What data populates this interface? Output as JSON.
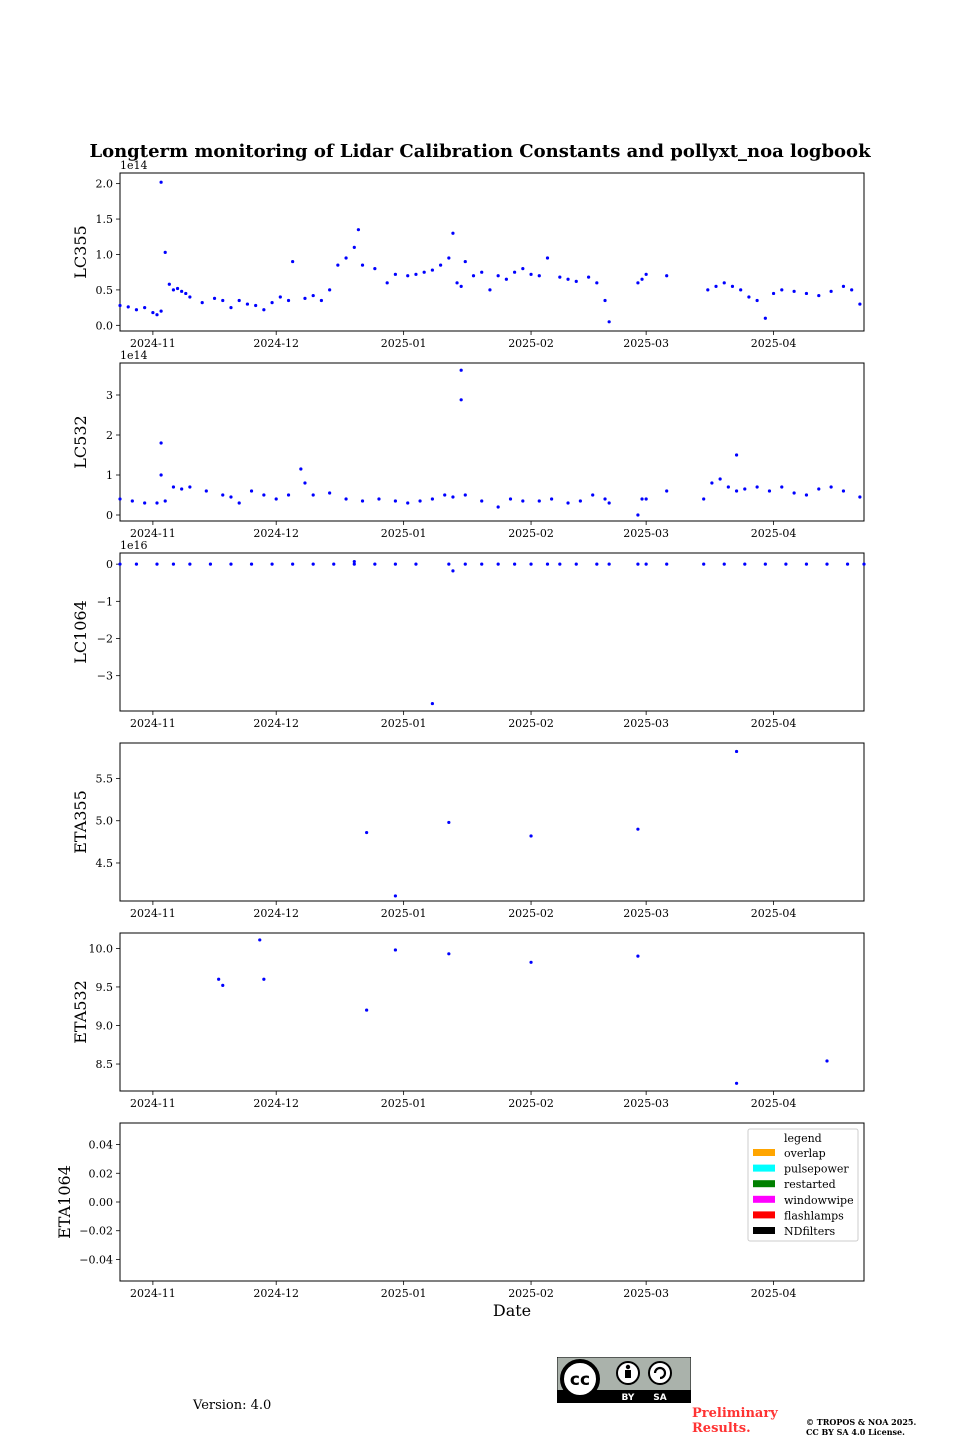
{
  "title": "Longterm monitoring of Lidar Calibration Constants and pollyxt_noa logbook",
  "footer": {
    "version": "Version: 4.0",
    "preliminary_line1": "Preliminary",
    "preliminary_line2": "Results.",
    "copyright_line1": "© TROPOS & NOA 2025.",
    "copyright_line2": "CC BY SA 4.0 License.",
    "license_badge": {
      "cc": "cc",
      "by": "BY",
      "sa": "SA"
    }
  },
  "chart_data": [
    {
      "type": "scatter",
      "ylabel": "LC355",
      "exponent": "1e14",
      "color": "#0000ff",
      "ylim": [
        -0.08,
        2.15
      ],
      "yticks": [
        "0.0",
        "0.5",
        "1.0",
        "1.5",
        "2.0"
      ],
      "ytick_values": [
        0.0,
        0.5,
        1.0,
        1.5,
        2.0
      ],
      "xlim": [
        "2024-10-24",
        "2025-04-23"
      ],
      "xticks": [
        "2024-11",
        "2024-12",
        "2025-01",
        "2025-02",
        "2025-03",
        "2025-04"
      ],
      "x": [
        "2024-10-24",
        "2024-10-26",
        "2024-10-28",
        "2024-10-30",
        "2024-11-01",
        "2024-11-02",
        "2024-11-03",
        "2024-11-03",
        "2024-11-04",
        "2024-11-05",
        "2024-11-06",
        "2024-11-07",
        "2024-11-08",
        "2024-11-09",
        "2024-11-10",
        "2024-11-13",
        "2024-11-16",
        "2024-11-18",
        "2024-11-20",
        "2024-11-22",
        "2024-11-24",
        "2024-11-26",
        "2024-11-28",
        "2024-11-30",
        "2024-12-02",
        "2024-12-04",
        "2024-12-05",
        "2024-12-08",
        "2024-12-10",
        "2024-12-12",
        "2024-12-14",
        "2024-12-16",
        "2024-12-18",
        "2024-12-20",
        "2024-12-21",
        "2024-12-22",
        "2024-12-25",
        "2024-12-28",
        "2024-12-30",
        "2025-01-02",
        "2025-01-04",
        "2025-01-06",
        "2025-01-08",
        "2025-01-10",
        "2025-01-12",
        "2025-01-13",
        "2025-01-14",
        "2025-01-15",
        "2025-01-16",
        "2025-01-18",
        "2025-01-20",
        "2025-01-22",
        "2025-01-24",
        "2025-01-26",
        "2025-01-28",
        "2025-01-30",
        "2025-02-01",
        "2025-02-03",
        "2025-02-05",
        "2025-02-08",
        "2025-02-10",
        "2025-02-12",
        "2025-02-15",
        "2025-02-17",
        "2025-02-19",
        "2025-02-20",
        "2025-02-27",
        "2025-02-28",
        "2025-03-01",
        "2025-03-06",
        "2025-03-16",
        "2025-03-18",
        "2025-03-20",
        "2025-03-22",
        "2025-03-24",
        "2025-03-26",
        "2025-03-28",
        "2025-03-30",
        "2025-04-01",
        "2025-04-03",
        "2025-04-06",
        "2025-04-09",
        "2025-04-12",
        "2025-04-15",
        "2025-04-18",
        "2025-04-20",
        "2025-04-22"
      ],
      "y": [
        0.28,
        0.26,
        0.22,
        0.25,
        0.18,
        0.15,
        0.2,
        2.02,
        1.03,
        0.58,
        0.5,
        0.52,
        0.48,
        0.45,
        0.4,
        0.32,
        0.38,
        0.35,
        0.25,
        0.35,
        0.3,
        0.28,
        0.22,
        0.32,
        0.4,
        0.35,
        0.9,
        0.38,
        0.42,
        0.35,
        0.5,
        0.85,
        0.95,
        1.1,
        1.35,
        0.85,
        0.8,
        0.6,
        0.72,
        0.7,
        0.72,
        0.75,
        0.78,
        0.85,
        0.95,
        1.3,
        0.6,
        0.55,
        0.9,
        0.7,
        0.75,
        0.5,
        0.7,
        0.65,
        0.75,
        0.8,
        0.72,
        0.7,
        0.95,
        0.68,
        0.65,
        0.62,
        0.68,
        0.6,
        0.35,
        0.05,
        0.6,
        0.65,
        0.72,
        0.7,
        0.5,
        0.55,
        0.6,
        0.55,
        0.5,
        0.4,
        0.35,
        0.1,
        0.45,
        0.5,
        0.48,
        0.45,
        0.42,
        0.48,
        0.55,
        0.5,
        0.3
      ]
    },
    {
      "type": "scatter",
      "ylabel": "LC532",
      "exponent": "1e14",
      "color": "#0000ff",
      "ylim": [
        -0.15,
        3.8
      ],
      "yticks": [
        "0",
        "1",
        "2",
        "3"
      ],
      "ytick_values": [
        0,
        1,
        2,
        3
      ],
      "xlim": [
        "2024-10-24",
        "2025-04-23"
      ],
      "xticks": [
        "2024-11",
        "2024-12",
        "2025-01",
        "2025-02",
        "2025-03",
        "2025-04"
      ],
      "x": [
        "2024-10-24",
        "2024-10-27",
        "2024-10-30",
        "2024-11-02",
        "2024-11-03",
        "2024-11-03",
        "2024-11-04",
        "2024-11-06",
        "2024-11-08",
        "2024-11-10",
        "2024-11-14",
        "2024-11-18",
        "2024-11-20",
        "2024-11-22",
        "2024-11-25",
        "2024-11-28",
        "2024-12-01",
        "2024-12-04",
        "2024-12-07",
        "2024-12-08",
        "2024-12-10",
        "2024-12-14",
        "2024-12-18",
        "2024-12-22",
        "2024-12-26",
        "2024-12-30",
        "2025-01-02",
        "2025-01-05",
        "2025-01-08",
        "2025-01-11",
        "2025-01-13",
        "2025-01-15",
        "2025-01-15",
        "2025-01-16",
        "2025-01-20",
        "2025-01-24",
        "2025-01-27",
        "2025-01-30",
        "2025-02-03",
        "2025-02-06",
        "2025-02-10",
        "2025-02-13",
        "2025-02-16",
        "2025-02-19",
        "2025-02-20",
        "2025-02-27",
        "2025-02-28",
        "2025-03-01",
        "2025-03-06",
        "2025-03-15",
        "2025-03-17",
        "2025-03-19",
        "2025-03-21",
        "2025-03-23",
        "2025-03-23",
        "2025-03-25",
        "2025-03-28",
        "2025-03-31",
        "2025-04-03",
        "2025-04-06",
        "2025-04-09",
        "2025-04-12",
        "2025-04-15",
        "2025-04-18",
        "2025-04-22"
      ],
      "y": [
        0.4,
        0.35,
        0.3,
        0.3,
        1.8,
        1.0,
        0.35,
        0.7,
        0.65,
        0.7,
        0.6,
        0.5,
        0.45,
        0.3,
        0.6,
        0.5,
        0.4,
        0.5,
        1.15,
        0.8,
        0.5,
        0.55,
        0.4,
        0.35,
        0.4,
        0.35,
        0.3,
        0.35,
        0.4,
        0.5,
        0.45,
        2.88,
        3.62,
        0.5,
        0.35,
        0.2,
        0.4,
        0.35,
        0.35,
        0.4,
        0.3,
        0.35,
        0.5,
        0.4,
        0.3,
        0.0,
        0.4,
        0.4,
        0.6,
        0.4,
        0.8,
        0.9,
        0.7,
        0.6,
        1.5,
        0.65,
        0.7,
        0.6,
        0.7,
        0.55,
        0.5,
        0.65,
        0.7,
        0.6,
        0.45
      ]
    },
    {
      "type": "scatter",
      "ylabel": "LC1064",
      "exponent": "1e16",
      "color": "#0000ff",
      "ylim": [
        -3.95,
        0.3
      ],
      "yticks": [
        "0",
        "−1",
        "−2",
        "−3"
      ],
      "ytick_values": [
        0,
        -1,
        -2,
        -3
      ],
      "xlim": [
        "2024-10-24",
        "2025-04-23"
      ],
      "xticks": [
        "2024-11",
        "2024-12",
        "2025-01",
        "2025-02",
        "2025-03",
        "2025-04"
      ],
      "x": [
        "2024-10-24",
        "2024-10-28",
        "2024-11-02",
        "2024-11-06",
        "2024-11-10",
        "2024-11-15",
        "2024-11-20",
        "2024-11-25",
        "2024-11-30",
        "2024-12-05",
        "2024-12-10",
        "2024-12-15",
        "2024-12-20",
        "2024-12-20",
        "2024-12-25",
        "2024-12-30",
        "2025-01-04",
        "2025-01-08",
        "2025-01-12",
        "2025-01-13",
        "2025-01-16",
        "2025-01-20",
        "2025-01-24",
        "2025-01-28",
        "2025-02-01",
        "2025-02-05",
        "2025-02-08",
        "2025-02-12",
        "2025-02-17",
        "2025-02-20",
        "2025-02-27",
        "2025-03-01",
        "2025-03-06",
        "2025-03-15",
        "2025-03-20",
        "2025-03-25",
        "2025-03-30",
        "2025-04-04",
        "2025-04-09",
        "2025-04-14",
        "2025-04-19",
        "2025-04-23"
      ],
      "y": [
        0.0,
        0.0,
        0.0,
        0.0,
        0.0,
        0.0,
        0.0,
        0.0,
        0.0,
        0.0,
        0.0,
        0.0,
        0.0,
        0.07,
        0.0,
        0.0,
        0.0,
        -3.75,
        0.0,
        -0.18,
        0.0,
        0.0,
        0.0,
        0.0,
        0.0,
        0.0,
        0.0,
        0.0,
        0.0,
        0.0,
        0.0,
        0.0,
        0.0,
        0.0,
        0.0,
        0.0,
        0.0,
        0.0,
        0.0,
        0.0,
        0.0,
        0.0
      ]
    },
    {
      "type": "scatter",
      "ylabel": "ETA355",
      "exponent": "",
      "color": "#0000ff",
      "ylim": [
        4.05,
        5.92
      ],
      "yticks": [
        "4.5",
        "5.0",
        "5.5"
      ],
      "ytick_values": [
        4.5,
        5.0,
        5.5
      ],
      "xlim": [
        "2024-10-24",
        "2025-04-23"
      ],
      "xticks": [
        "2024-11",
        "2024-12",
        "2025-01",
        "2025-02",
        "2025-03",
        "2025-04"
      ],
      "x": [
        "2024-12-23",
        "2024-12-30",
        "2025-01-12",
        "2025-02-01",
        "2025-02-27",
        "2025-03-23"
      ],
      "y": [
        4.86,
        4.11,
        4.98,
        4.82,
        4.9,
        5.82
      ]
    },
    {
      "type": "scatter",
      "ylabel": "ETA532",
      "exponent": "",
      "color": "#0000ff",
      "ylim": [
        8.15,
        10.2
      ],
      "yticks": [
        "8.5",
        "9.0",
        "9.5",
        "10.0"
      ],
      "ytick_values": [
        8.5,
        9.0,
        9.5,
        10.0
      ],
      "xlim": [
        "2024-10-24",
        "2025-04-23"
      ],
      "xticks": [
        "2024-11",
        "2024-12",
        "2025-01",
        "2025-02",
        "2025-03",
        "2025-04"
      ],
      "x": [
        "2024-11-17",
        "2024-11-18",
        "2024-11-27",
        "2024-11-28",
        "2024-12-23",
        "2024-12-30",
        "2025-01-12",
        "2025-02-01",
        "2025-02-27",
        "2025-03-23",
        "2025-04-14"
      ],
      "y": [
        9.6,
        9.52,
        10.11,
        9.6,
        9.2,
        9.98,
        9.93,
        9.82,
        9.9,
        8.25,
        8.54
      ]
    },
    {
      "type": "scatter",
      "ylabel": "ETA1064",
      "exponent": "",
      "color": "#0000ff",
      "xlabel": "Date",
      "ylim": [
        -0.055,
        0.055
      ],
      "yticks": [
        "0.04",
        "0.02",
        "0.00",
        "−0.02",
        "−0.04"
      ],
      "ytick_values": [
        0.04,
        0.02,
        0.0,
        -0.02,
        -0.04
      ],
      "xlim": [
        "2024-10-24",
        "2025-04-23"
      ],
      "xticks": [
        "2024-11",
        "2024-12",
        "2025-01",
        "2025-02",
        "2025-03",
        "2025-04"
      ],
      "x": [],
      "y": [],
      "legend": {
        "title": "legend",
        "placement": "top-right",
        "entries": [
          {
            "label": "overlap",
            "color": "#ffa500"
          },
          {
            "label": "pulsepower",
            "color": "#00ffff"
          },
          {
            "label": "restarted",
            "color": "#008000"
          },
          {
            "label": "windowwipe",
            "color": "#ff00ff"
          },
          {
            "label": "flashlamps",
            "color": "#ff0000"
          },
          {
            "label": "NDfilters",
            "color": "#000000"
          }
        ]
      }
    }
  ]
}
